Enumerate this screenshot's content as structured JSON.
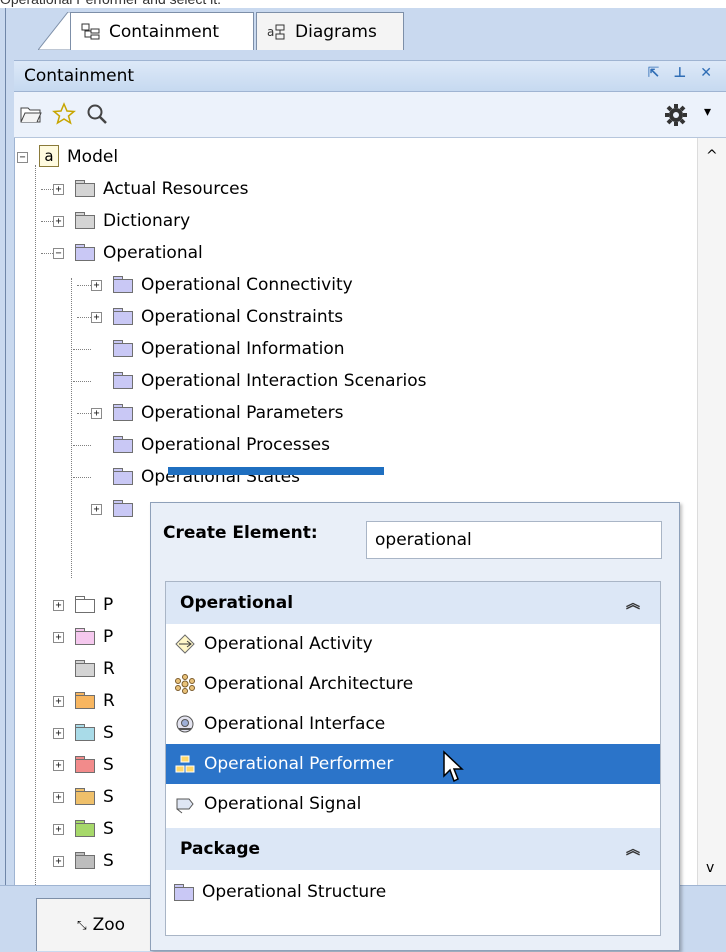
{
  "caption": "Operational Performer and select it.",
  "tabs": [
    {
      "label": "Containment",
      "icon": "containment-icon",
      "active": true
    },
    {
      "label": "Diagrams",
      "icon": "diagrams-icon",
      "active": false
    }
  ],
  "panel": {
    "title": "Containment",
    "header_icons": [
      "undock-icon",
      "pin-icon",
      "close-icon"
    ]
  },
  "toolbar": {
    "icons": [
      "open-folder-icon",
      "star-icon",
      "search-icon",
      "gear-icon"
    ]
  },
  "tree": {
    "root": "Model",
    "items": [
      {
        "label": "Actual Resources",
        "level": 1,
        "expander": "+"
      },
      {
        "label": "Dictionary",
        "level": 1,
        "expander": "+"
      },
      {
        "label": "Operational",
        "level": 1,
        "expander": "-"
      },
      {
        "label": "Operational Connectivity",
        "level": 2,
        "expander": "+"
      },
      {
        "label": "Operational Constraints",
        "level": 2,
        "expander": "+"
      },
      {
        "label": "Operational Information",
        "level": 2,
        "expander": ""
      },
      {
        "label": "Operational Interaction Scenarios",
        "level": 2,
        "expander": ""
      },
      {
        "label": "Operational Parameters",
        "level": 2,
        "expander": "+"
      },
      {
        "label": "Operational Processes",
        "level": 2,
        "expander": ""
      },
      {
        "label": "Operational States",
        "level": 2,
        "expander": ""
      }
    ],
    "partial_items": [
      "P",
      "P",
      "R",
      "R",
      "S",
      "S",
      "S",
      "S",
      "S"
    ]
  },
  "popup": {
    "heading": "Create Element:",
    "search_value": "operational",
    "groups": [
      {
        "label": "Operational",
        "items": [
          {
            "label": "Operational Activity",
            "icon": "activity-icon"
          },
          {
            "label": "Operational Architecture",
            "icon": "architecture-icon"
          },
          {
            "label": "Operational Interface",
            "icon": "interface-icon"
          },
          {
            "label": "Operational Performer",
            "icon": "performer-icon",
            "selected": true
          },
          {
            "label": "Operational Signal",
            "icon": "signal-icon"
          }
        ]
      },
      {
        "label": "Package",
        "items": [
          {
            "label": "Operational Structure",
            "icon": "package-icon"
          }
        ]
      }
    ]
  },
  "bottom_tab": {
    "label": "Zoo",
    "icon": "zoom-icon"
  },
  "colors": {
    "selection": "#2b74c9",
    "frame": "#c9d9ef",
    "group_bg": "#dce7f6"
  }
}
